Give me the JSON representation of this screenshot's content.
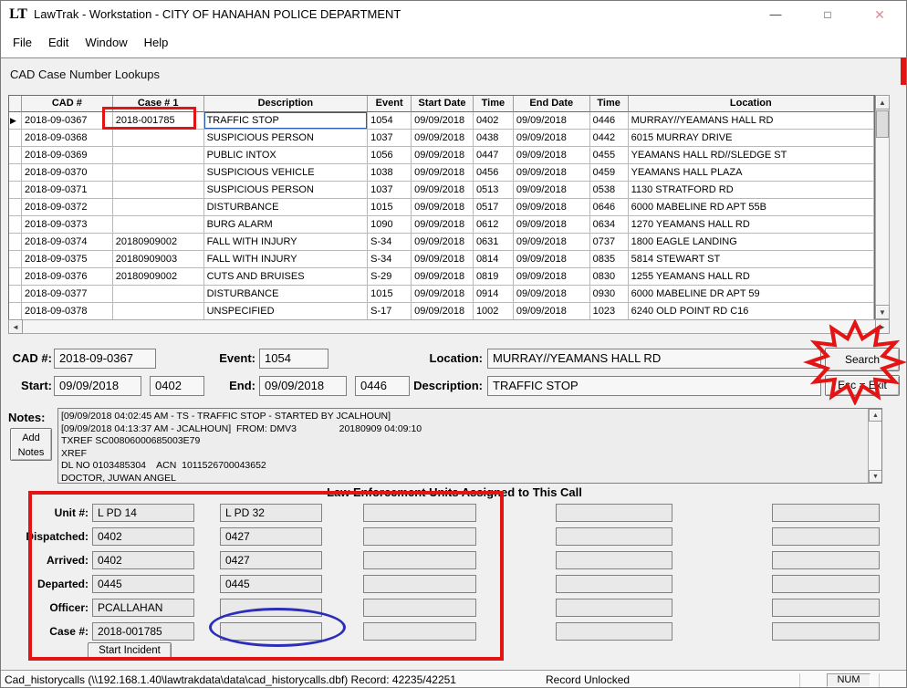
{
  "window": {
    "title": "LawTrak - Workstation - CITY OF HANAHAN POLICE DEPARTMENT",
    "logo": "LT",
    "controls": {
      "minimize": "—",
      "maximize": "□",
      "close": "✕"
    }
  },
  "menu": [
    "File",
    "Edit",
    "Window",
    "Help"
  ],
  "section_title": "CAD Case Number Lookups",
  "table": {
    "columns": [
      "CAD #",
      "Case # 1",
      "Description",
      "Event",
      "Start Date",
      "Time",
      "End Date",
      "Time",
      "Location"
    ],
    "rows": [
      [
        "2018-09-0367",
        "2018-001785",
        "TRAFFIC STOP",
        "1054",
        "09/09/2018",
        "0402",
        "09/09/2018",
        "0446",
        "MURRAY//YEAMANS HALL RD"
      ],
      [
        "2018-09-0368",
        "",
        "SUSPICIOUS PERSON",
        "1037",
        "09/09/2018",
        "0438",
        "09/09/2018",
        "0442",
        "6015 MURRAY DRIVE"
      ],
      [
        "2018-09-0369",
        "",
        "PUBLIC INTOX",
        "1056",
        "09/09/2018",
        "0447",
        "09/09/2018",
        "0455",
        "YEAMANS HALL RD//SLEDGE ST"
      ],
      [
        "2018-09-0370",
        "",
        "SUSPICIOUS VEHICLE",
        "1038",
        "09/09/2018",
        "0456",
        "09/09/2018",
        "0459",
        "YEAMANS HALL PLAZA"
      ],
      [
        "2018-09-0371",
        "",
        "SUSPICIOUS PERSON",
        "1037",
        "09/09/2018",
        "0513",
        "09/09/2018",
        "0538",
        "1130 STRATFORD RD"
      ],
      [
        "2018-09-0372",
        "",
        "DISTURBANCE",
        "1015",
        "09/09/2018",
        "0517",
        "09/09/2018",
        "0646",
        "6000 MABELINE RD APT 55B"
      ],
      [
        "2018-09-0373",
        "",
        "BURG ALARM",
        "1090",
        "09/09/2018",
        "0612",
        "09/09/2018",
        "0634",
        "1270 YEAMANS HALL RD"
      ],
      [
        "2018-09-0374",
        "20180909002",
        "FALL WITH INJURY",
        "S-34",
        "09/09/2018",
        "0631",
        "09/09/2018",
        "0737",
        "1800 EAGLE LANDING"
      ],
      [
        "2018-09-0375",
        "20180909003",
        "FALL WITH INJURY",
        "S-34",
        "09/09/2018",
        "0814",
        "09/09/2018",
        "0835",
        "5814 STEWART ST"
      ],
      [
        "2018-09-0376",
        "20180909002",
        "CUTS AND BRUISES",
        "S-29",
        "09/09/2018",
        "0819",
        "09/09/2018",
        "0830",
        "1255 YEAMANS HALL RD"
      ],
      [
        "2018-09-0377",
        "",
        "DISTURBANCE",
        "1015",
        "09/09/2018",
        "0914",
        "09/09/2018",
        "0930",
        "6000 MABELINE DR APT 59"
      ],
      [
        "2018-09-0378",
        "",
        "UNSPECIFIED",
        "S-17",
        "09/09/2018",
        "1002",
        "09/09/2018",
        "1023",
        "6240 OLD POINT RD C16"
      ]
    ]
  },
  "detail": {
    "cad_label": "CAD #:",
    "cad_value": "2018-09-0367",
    "event_label": "Event:",
    "event_value": "1054",
    "location_label": "Location:",
    "location_value": "MURRAY//YEAMANS HALL RD",
    "start_label": "Start:",
    "start_date": "09/09/2018",
    "start_time": "0402",
    "end_label": "End:",
    "end_date": "09/09/2018",
    "end_time": "0446",
    "description_label": "Description:",
    "description_value": "TRAFFIC STOP",
    "search_button": "Search",
    "exit_button": "Esc = Exit"
  },
  "notes": {
    "label": "Notes:",
    "add_button": "Add Notes",
    "lines": [
      "[09/09/2018 04:02:45 AM - TS - TRAFFIC STOP - STARTED BY JCALHOUN]",
      "[09/09/2018 04:13:37 AM - JCALHOUN]  FROM: DMV3                20180909 04:09:10",
      "TXREF SC00806000685003E79",
      "XREF",
      "DL NO 0103485304    ACN  1011526700043652",
      "DOCTOR, JUWAN ANGEL"
    ]
  },
  "units": {
    "header": "Law Enforcement Units Assigned to This Call",
    "row_labels": [
      "Unit #:",
      "Dispatched:",
      "Arrived:",
      "Departed:",
      "Officer:",
      "Case #:"
    ],
    "columns": [
      [
        "L PD  14",
        "0402",
        "0402",
        "0445",
        "PCALLAHAN",
        "2018-001785"
      ],
      [
        "L PD  32",
        "0427",
        "0427",
        "0445",
        "",
        ""
      ],
      [
        "",
        "",
        "",
        "",
        "",
        ""
      ],
      [
        "",
        "",
        "",
        "",
        "",
        ""
      ],
      [
        "",
        "",
        "",
        "",
        "",
        ""
      ]
    ],
    "start_incident_button": "Start Incident"
  },
  "status_bar": {
    "left": "Cad_historycalls (\\\\192.168.1.40\\lawtrakdata\\data\\cad_historycalls.dbf) Record: 42235/42251",
    "middle": "Record Unlocked",
    "num": "NUM"
  },
  "annotations": {
    "red": "#e21414",
    "blue": "#2d2dbb"
  }
}
